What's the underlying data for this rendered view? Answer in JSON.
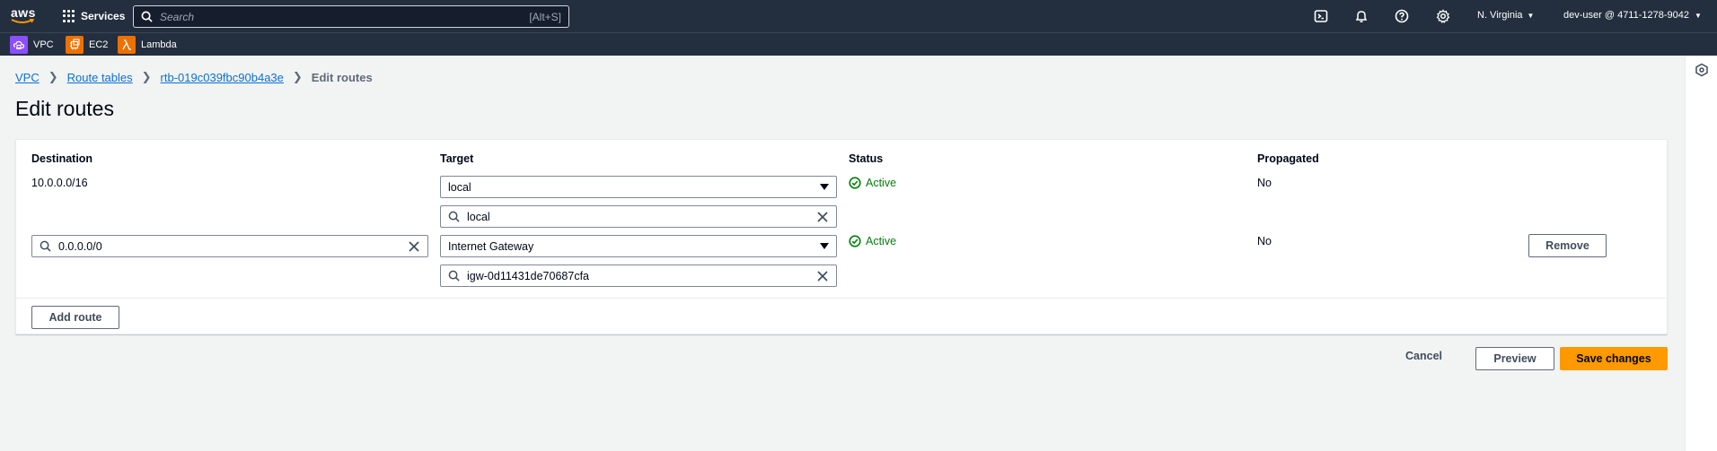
{
  "topnav": {
    "logo_text": "aws",
    "services_label": "Services",
    "search_placeholder": "Search",
    "search_shortcut": "[Alt+S]",
    "region": "N. Virginia",
    "account": "dev-user @ 4711-1278-9042"
  },
  "favorites": [
    {
      "label": "VPC",
      "color": "#8c4fff",
      "icon": "vpc-icon"
    },
    {
      "label": "EC2",
      "color": "#ed7100",
      "icon": "ec2-icon"
    },
    {
      "label": "Lambda",
      "color": "#ed7100",
      "icon": "lambda-icon"
    }
  ],
  "breadcrumb": {
    "items": [
      "VPC",
      "Route tables",
      "rtb-019c039fbc90b4a3e"
    ],
    "current": "Edit routes"
  },
  "page_title": "Edit routes",
  "table": {
    "headers": {
      "destination": "Destination",
      "target": "Target",
      "status": "Status",
      "propagated": "Propagated"
    },
    "rows": [
      {
        "destination": "10.0.0.0/16",
        "target_type": "local",
        "target_value": "local",
        "status": "Active",
        "propagated": "No"
      },
      {
        "destination": "0.0.0.0/0",
        "target_type": "Internet Gateway",
        "target_value": "igw-0d11431de70687cfa",
        "status": "Active",
        "propagated": "No",
        "remove_label": "Remove"
      }
    ],
    "add_route_label": "Add route"
  },
  "actions": {
    "cancel": "Cancel",
    "preview": "Preview",
    "save": "Save changes"
  },
  "colors": {
    "nav_bg": "#232f3e",
    "link": "#0972d3",
    "success": "#037f0c",
    "primary": "#ff9900"
  }
}
